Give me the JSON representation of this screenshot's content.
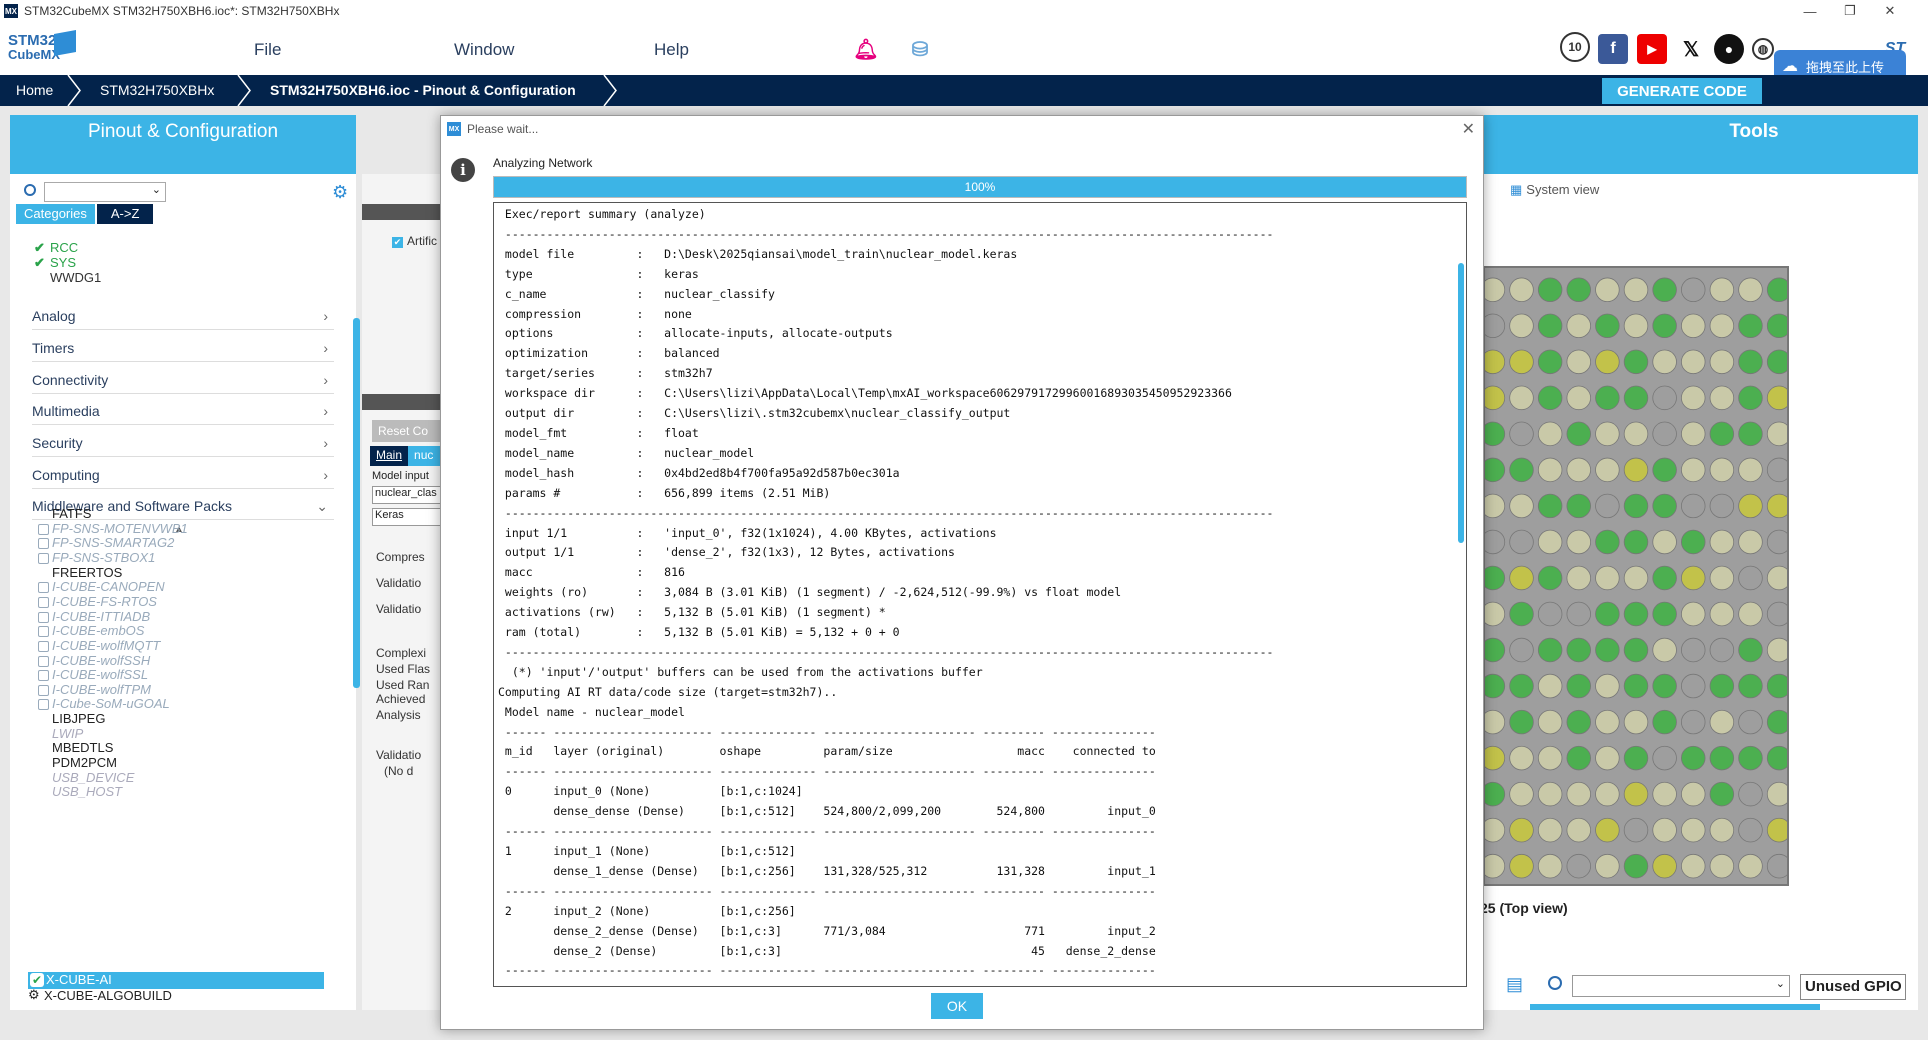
{
  "window": {
    "title": "STM32CubeMX STM32H750XBH6.ioc*: STM32H750XBHx",
    "app_icon": "MX",
    "controls": [
      "—",
      "❐",
      "✕"
    ]
  },
  "header": {
    "logo_line1": "STM32",
    "logo_line2": "CubeMX",
    "menu": [
      "File",
      "Window",
      "Help"
    ],
    "upload_badge": "拖拽至此上传"
  },
  "breadcrumb": {
    "items": [
      "Home",
      "STM32H750XBHx",
      "STM32H750XBH6.ioc - Pinout & Configuration"
    ],
    "generate_label": "GENERATE CODE"
  },
  "left": {
    "header": "Pinout & Configuration",
    "tabs": [
      "Categories",
      "A->Z"
    ],
    "system_items": [
      {
        "label": "RCC",
        "checked": true
      },
      {
        "label": "SYS",
        "checked": true
      },
      {
        "label": "WWDG1",
        "checked": false
      }
    ],
    "categories": [
      "Analog",
      "Timers",
      "Connectivity",
      "Multimedia",
      "Security",
      "Computing",
      "Middleware and Software Packs"
    ],
    "middleware": [
      {
        "label": "FATFS",
        "style": "blk"
      },
      {
        "label": "FP-SNS-MOTENVWB1",
        "style": "dim"
      },
      {
        "label": "FP-SNS-SMARTAG2",
        "style": "dim"
      },
      {
        "label": "FP-SNS-STBOX1",
        "style": "dim"
      },
      {
        "label": "FREERTOS",
        "style": "blk"
      },
      {
        "label": "I-CUBE-CANOPEN",
        "style": "dim"
      },
      {
        "label": "I-CUBE-FS-RTOS",
        "style": "dim"
      },
      {
        "label": "I-CUBE-ITTIADB",
        "style": "dim"
      },
      {
        "label": "I-CUBE-embOS",
        "style": "dim"
      },
      {
        "label": "I-CUBE-wolfMQTT",
        "style": "dim"
      },
      {
        "label": "I-CUBE-wolfSSH",
        "style": "dim"
      },
      {
        "label": "I-CUBE-wolfSSL",
        "style": "dim"
      },
      {
        "label": "I-CUBE-wolfTPM",
        "style": "dim"
      },
      {
        "label": "I-Cube-SoM-uGOAL",
        "style": "dim"
      },
      {
        "label": "LIBJPEG",
        "style": "blk"
      },
      {
        "label": "LWIP",
        "style": "dim2"
      },
      {
        "label": "MBEDTLS",
        "style": "blk"
      },
      {
        "label": "PDM2PCM",
        "style": "blk"
      },
      {
        "label": "USB_DEVICE",
        "style": "dim2"
      },
      {
        "label": "USB_HOST",
        "style": "dim2"
      }
    ],
    "selected_pack": "X-CUBE-AI",
    "last_pack": "X-CUBE-ALGOBUILD"
  },
  "middle": {
    "artific": "Artific",
    "reset_btn": "Reset Co",
    "main_tab": "Main",
    "nuc_tab": "nuc",
    "model_input_label": "Model input",
    "model_input_value": "nuclear_clas",
    "keras_value": "Keras",
    "labels": [
      "Compres",
      "Validatio",
      "Validatio",
      "Complexi",
      "Used Flas",
      "Used Ran",
      "Achieved",
      "Analysis",
      "Validatio",
      "(No d"
    ]
  },
  "tools": {
    "header": "Tools",
    "system_view": "System view",
    "top_view": "25 (Top view)",
    "unused_gpio": "Unused GPIO"
  },
  "modal": {
    "title": "Please wait...",
    "status": "Analyzing Network",
    "progress_pct": 100,
    "progress_label": "100%",
    "ok_label": "OK",
    "log_lines": [
      " Exec/report summary (analyze)",
      " ---------------------------------------------------------------------------------------------------------------",
      " model file         :   D:\\Desk\\2025qiansai\\model_train\\nuclear_model.keras",
      " type               :   keras",
      " c_name             :   nuclear_classify",
      " compression        :   none",
      " options            :   allocate-inputs, allocate-outputs",
      " optimization       :   balanced",
      " target/series      :   stm32h7",
      " workspace dir      :   C:\\Users\\lizi\\AppData\\Local\\Temp\\mxAI_workspace60629791729960016893035450952923366",
      " output dir         :   C:\\Users\\lizi\\.stm32cubemx\\nuclear_classify_output",
      " model_fmt          :   float",
      " model_name         :   nuclear_model",
      " model_hash         :   0x4bd2ed8b4f700fa95a92d587b0ec301a",
      " params #           :   656,899 items (2.51 MiB)",
      " ---------------------------------------------------------------------------------------------------------------",
      " input 1/1          :   'input_0', f32(1x1024), 4.00 KBytes, activations",
      " output 1/1         :   'dense_2', f32(1x3), 12 Bytes, activations",
      " macc               :   816",
      " weights (ro)       :   3,084 B (3.01 KiB) (1 segment) / -2,624,512(-99.9%) vs float model",
      " activations (rw)   :   5,132 B (5.01 KiB) (1 segment) *",
      " ram (total)        :   5,132 B (5.01 KiB) = 5,132 + 0 + 0",
      " ---------------------------------------------------------------------------------------------------------------",
      "  (*) 'input'/'output' buffers can be used from the activations buffer",
      "Computing AI RT data/code size (target=stm32h7)..",
      " Model name - nuclear_model",
      " ------ ----------------------- -------------- ---------------------- --------- ---------------",
      " m_id   layer (original)        oshape         param/size                  macc    connected to",
      " ------ ----------------------- -------------- ---------------------- --------- ---------------",
      " 0      input_0 (None)          [b:1,c:1024]",
      "        dense_dense (Dense)     [b:1,c:512]    524,800/2,099,200        524,800         input_0",
      " ------ ----------------------- -------------- ---------------------- --------- ---------------",
      " 1      input_1 (None)          [b:1,c:512]",
      "        dense_1_dense (Dense)   [b:1,c:256]    131,328/525,312          131,328         input_1",
      " ------ ----------------------- -------------- ---------------------- --------- ---------------",
      " 2      input_2 (None)          [b:1,c:256]",
      "        dense_2_dense (Dense)   [b:1,c:3]      771/3,084                    771         input_2",
      "        dense_2 (Dense)         [b:1,c:3]                                    45   dense_2_dense",
      " ------ ----------------------- -------------- ---------------------- --------- ---------------"
    ]
  }
}
